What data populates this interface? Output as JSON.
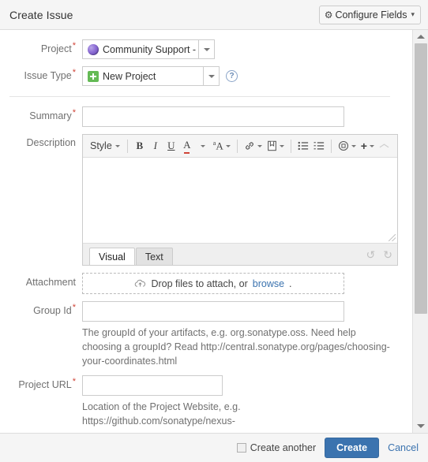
{
  "header": {
    "title": "Create Issue",
    "configure_fields_label": "Configure Fields",
    "gear_icon": "gear-icon",
    "caret": "▾"
  },
  "form": {
    "project": {
      "label": "Project",
      "required": "*",
      "value": "Community Support - ...",
      "icon": "project-avatar-icon"
    },
    "issue_type": {
      "label": "Issue Type",
      "required": "*",
      "value": "New Project",
      "icon": "new-project-icon",
      "help_icon": "?"
    },
    "summary": {
      "label": "Summary",
      "required": "*",
      "value": "",
      "placeholder": ""
    },
    "description": {
      "label": "Description",
      "value": "",
      "toolbar": {
        "style_label": "Style",
        "bold": "B",
        "italic": "I",
        "underline": "U",
        "text_color": "A",
        "background_color": "A",
        "link": "link-icon",
        "image": "image-icon",
        "bullet_list": "bullet-list-icon",
        "numbered_list": "numbered-list-icon",
        "mention": "mention-icon",
        "insert_more": "+",
        "collapse": "collapse-icon"
      },
      "tabs": [
        {
          "label": "Visual",
          "active": true
        },
        {
          "label": "Text",
          "active": false
        }
      ],
      "undo_icon": "↺",
      "redo_icon": "↻"
    },
    "attachment": {
      "label": "Attachment",
      "drop_text": "Drop files to attach, or",
      "browse_link": "browse",
      "trailing_period": ".",
      "cloud_icon": "cloud-upload-icon"
    },
    "group_id": {
      "label": "Group Id",
      "required": "*",
      "value": "",
      "help": "The groupId of your artifacts, e.g. org.sonatype.oss. Need help choosing a groupId? Read http://central.sonatype.org/pages/choosing-your-coordinates.html"
    },
    "project_url": {
      "label": "Project URL",
      "required": "*",
      "value": "",
      "help": "Location of the Project Website, e.g. https://github.com/sonatype/nexus-"
    }
  },
  "scrollbar": {
    "up_arrow": "scroll-up-icon",
    "down_arrow": "scroll-down-icon",
    "thumb_position_percent": 0,
    "thumb_size_percent": 72
  },
  "footer": {
    "create_another_label": "Create another",
    "create_another_checked": false,
    "create_label": "Create",
    "cancel_label": "Cancel"
  },
  "colors": {
    "accent_blue": "#3b73af",
    "required_red": "#d04437",
    "issue_type_green": "#64ba55",
    "header_grey": "#f5f5f5"
  }
}
